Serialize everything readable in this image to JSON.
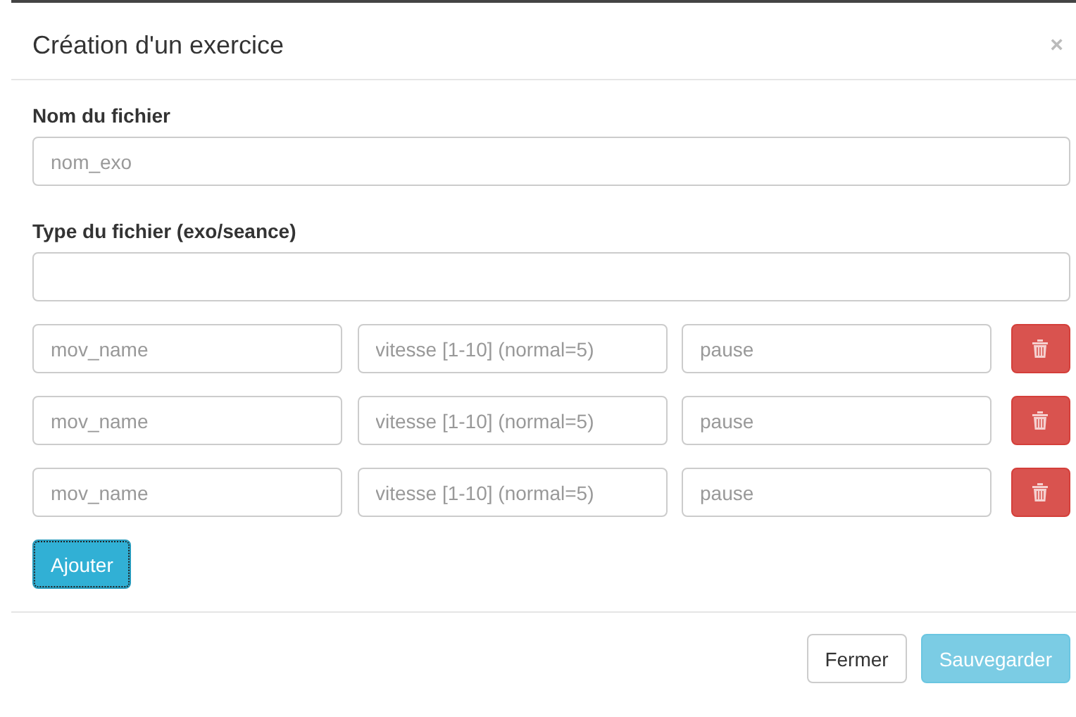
{
  "modal": {
    "title": "Création d'un exercice",
    "close": "×"
  },
  "fields": [
    {
      "label": "Nom du fichier",
      "placeholder": "nom_exo"
    },
    {
      "label": "Type du fichier (exo/seance)"
    }
  ],
  "movements": [
    {
      "name_placeholder": "mov_name",
      "speed_placeholder": "vitesse [1-10] (normal=5)",
      "pause_placeholder": "pause"
    },
    {
      "name_placeholder": "mov_name",
      "speed_placeholder": "vitesse [1-10] (normal=5)",
      "pause_placeholder": "pause"
    },
    {
      "name_placeholder": "mov_name",
      "speed_placeholder": "vitesse [1-10] (normal=5)",
      "pause_placeholder": "pause"
    }
  ],
  "add_button": {
    "label": "Ajouter",
    "focused": true
  },
  "footer_buttons": [
    {
      "label": "Fermer",
      "kind": "default",
      "disabled": false
    },
    {
      "label": "Sauvegarder",
      "kind": "primary",
      "disabled": true
    }
  ]
}
